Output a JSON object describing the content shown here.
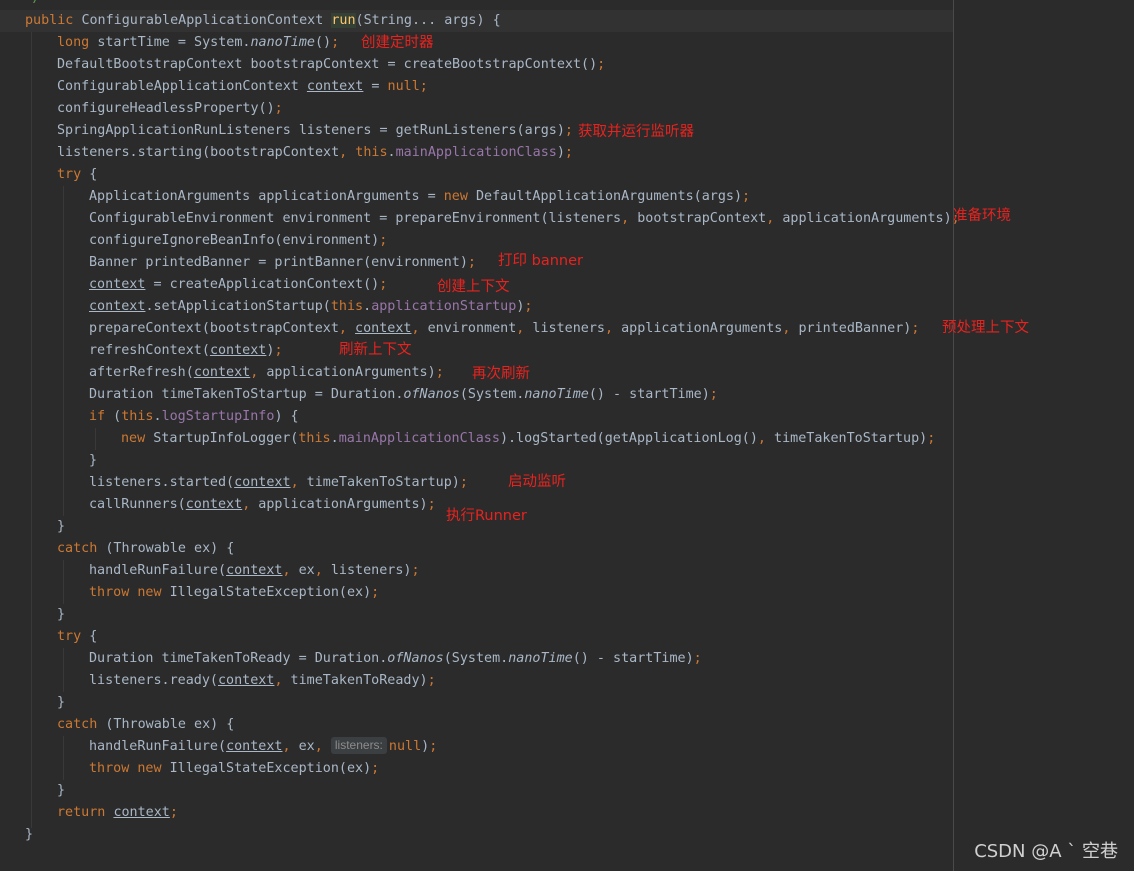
{
  "editor": {
    "partial_comment": "*/",
    "code": {
      "l1_public": "public",
      "l1_type": "ConfigurableApplicationContext",
      "l1_run": "run",
      "l1_params": "(String... args) {",
      "l2_long": "long",
      "l2_a": "startTime = System.",
      "l2_nano": "nanoTime",
      "l2_b": "()",
      "l3_a": "DefaultBootstrapContext bootstrapContext = createBootstrapContext()",
      "l4_a": "ConfigurableApplicationContext ",
      "context": "context",
      "l4_eq": " = ",
      "null": "null",
      "l5_a": "configureHeadlessProperty()",
      "l6_a": "SpringApplicationRunListeners listeners = getRunListeners(args)",
      "l7_a": "listeners.starting(bootstrapContext",
      "this": "this",
      "l7_field": "mainApplicationClass",
      "l7_end": ")",
      "try": "try",
      "brace_open": " {",
      "new": "new",
      "l9_a": "ApplicationArguments applicationArguments = ",
      "l9_b": "DefaultApplicationArguments(args)",
      "l10_a": "ConfigurableEnvironment environment = prepareEnvironment(listeners",
      "l10_b": " bootstrapContext",
      "l10_c": " applicationArguments)",
      "l11_a": "configureIgnoreBeanInfo(environment)",
      "l12_a": "Banner printedBanner = printBanner(environment)",
      "l13_a": " = createApplicationContext()",
      "l14_a": ".setApplicationStartup(",
      "l14_field": "applicationStartup",
      "l14_end": ")",
      "l15_a": "prepareContext(bootstrapContext",
      "l15_b": " environment",
      "l15_c": " listeners",
      "l15_d": " applicationArguments",
      "l15_e": " printedBanner)",
      "l16_a": "refreshContext(",
      "close_paren": ")",
      "l17_a": "afterRefresh(",
      "l17_b": " applicationArguments)",
      "l18_a": "Duration timeTakenToStartup = Duration.",
      "ofNanos": "ofNanos",
      "l18_b": "(System.",
      "l18_c": "() - startTime)",
      "if": "if",
      "l19_a": " (",
      "l19_field": "logStartupInfo",
      "l19_b": ") {",
      "l20_a": "StartupInfoLogger(",
      "l20_b": ").logStarted(getApplicationLog()",
      "l20_c": " timeTakenToStartup)",
      "brace_close": "}",
      "l22_a": "listeners.started(",
      "l22_b": " timeTakenToStartup)",
      "l23_a": "callRunners(",
      "catch": "catch",
      "catch_args": " (Throwable ex) {",
      "l26_a": "handleRunFailure(",
      "l26_b": " ex",
      "l26_c": " listeners)",
      "throw": "throw",
      "l27_a": "IllegalStateException(ex)",
      "l30_a": "Duration timeTakenToReady = Duration.",
      "l31_a": "listeners.ready(",
      "l31_b": " timeTakenToReady)",
      "hint_listeners": "listeners:",
      "l34_end": ")",
      "return": "return",
      "comma": ",",
      "semi": ";"
    }
  },
  "annotations": {
    "timer": "创建定时器",
    "listeners": "获取并运行监听器",
    "environment": "准备环境",
    "banner": "打印 banner",
    "create_context": "创建上下文",
    "prepare_context": "预处理上下文",
    "refresh": "刷新上下文",
    "refresh_again": "再次刷新",
    "start_listen": "启动监听",
    "runner": "执行Runner"
  },
  "watermark": "CSDN @A ` 空巷"
}
